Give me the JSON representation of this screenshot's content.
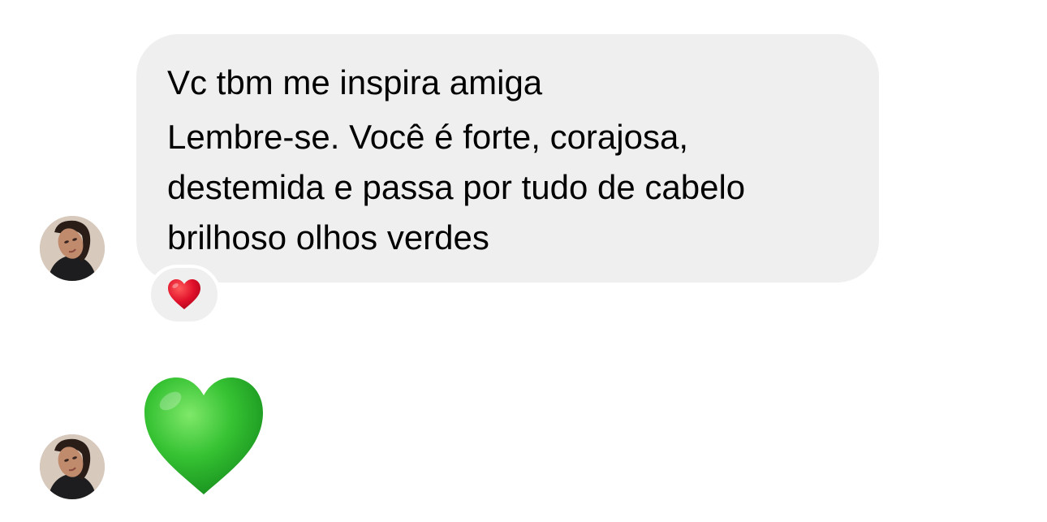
{
  "messages": [
    {
      "line1": "Vc tbm me inspira amiga",
      "body": "Lembre-se. Você é forte, corajosa, destemida e passa por tudo de cabelo brilhoso olhos verdes",
      "reaction_icon": "red-heart-icon"
    },
    {
      "emoji_icon": "green-heart-icon"
    }
  ],
  "colors": {
    "bubble": "#efefef",
    "red_heart": "#e0102a",
    "green_heart": "#2ec12e"
  }
}
